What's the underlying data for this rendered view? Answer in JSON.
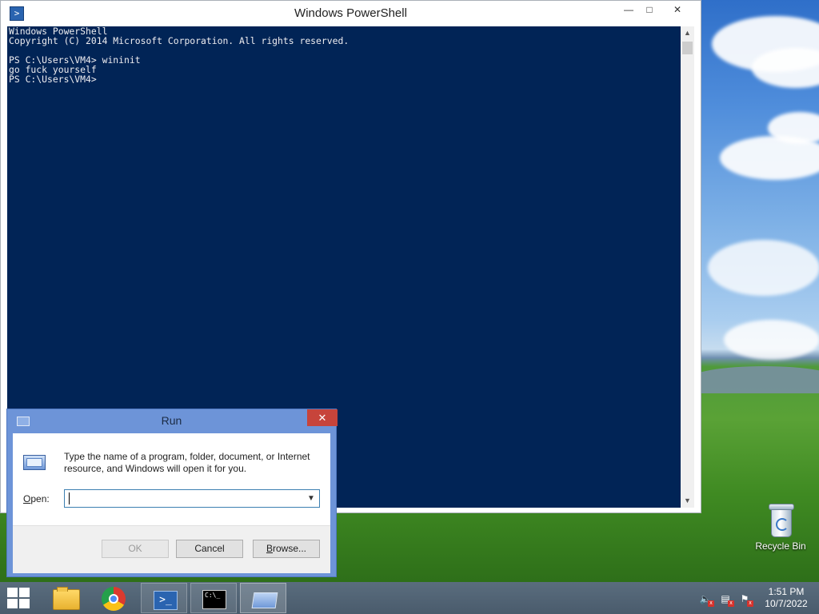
{
  "powershell": {
    "title": "Windows PowerShell",
    "icon": "powershell-icon",
    "console_lines": [
      "Windows PowerShell",
      "Copyright (C) 2014 Microsoft Corporation. All rights reserved.",
      "",
      "PS C:\\Users\\VM4> wininit",
      "go fuck yourself",
      "PS C:\\Users\\VM4>"
    ],
    "background_color": "#012456",
    "text_color": "#eeedf0"
  },
  "run_dialog": {
    "title": "Run",
    "description": "Type the name of a program, folder, document, or Internet resource, and Windows will open it for you.",
    "open_label": "Open:",
    "open_value": "",
    "ok_label": "OK",
    "cancel_label": "Cancel",
    "browse_label": "Browse...",
    "close_color": "#c7443b"
  },
  "desktop": {
    "recycle_bin_label": "Recycle Bin"
  },
  "taskbar": {
    "apps": [
      "file-explorer-icon",
      "chrome-icon",
      "powershell-icon",
      "cmd-icon",
      "run-icon"
    ],
    "clock_time": "1:51 PM",
    "clock_date": "10/7/2022"
  }
}
